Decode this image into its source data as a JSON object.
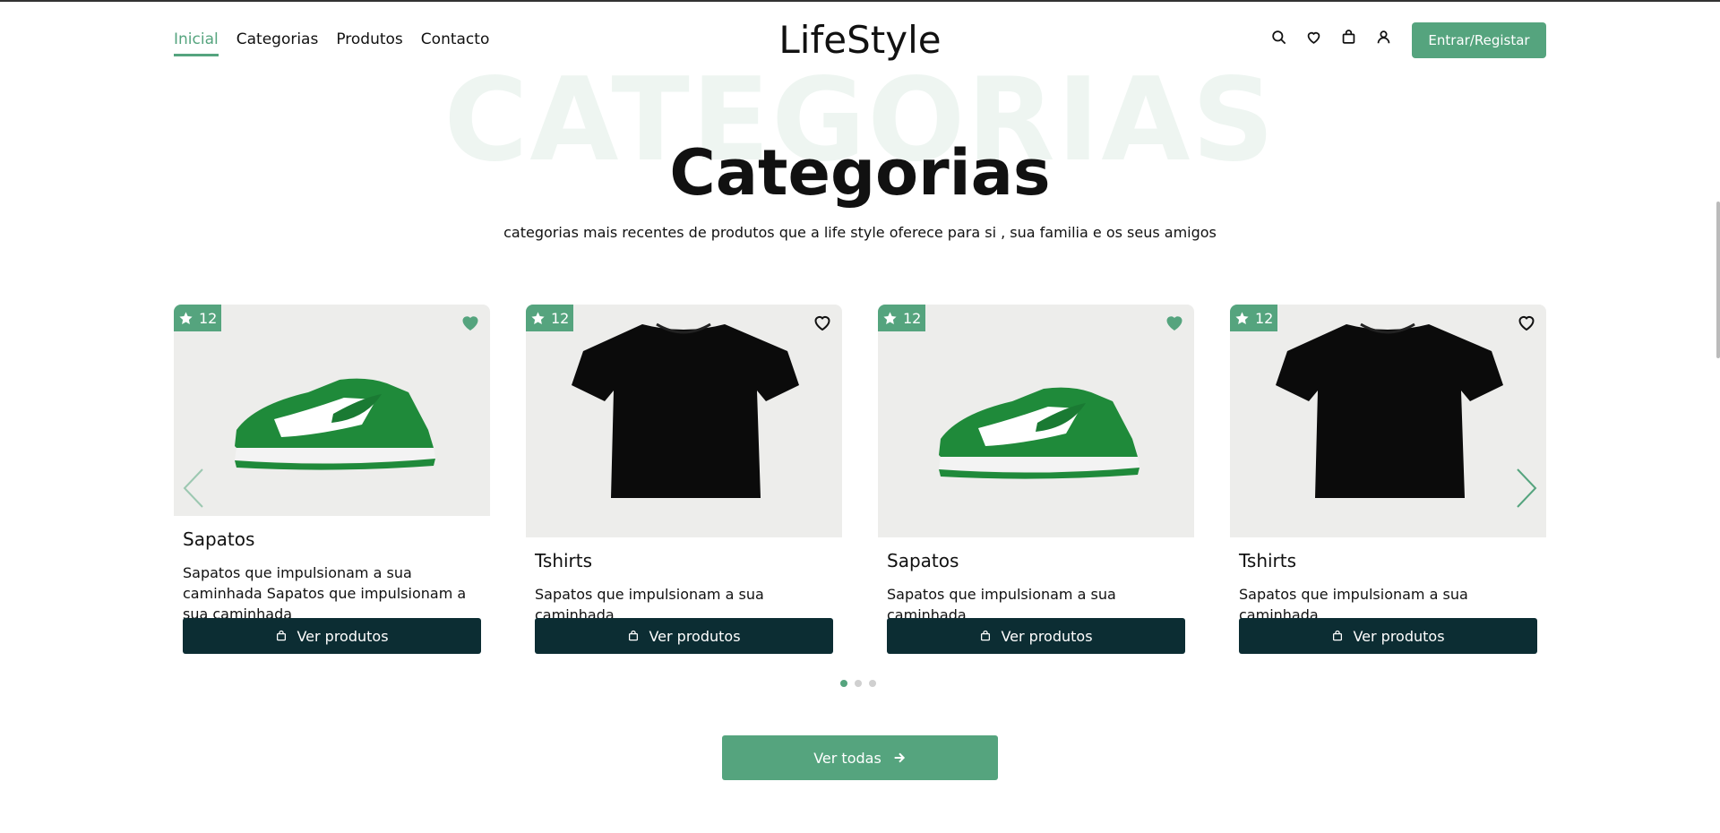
{
  "header": {
    "nav": [
      "Inicial",
      "Categorias",
      "Produtos",
      "Contacto"
    ],
    "active_nav": "Inicial",
    "logo": "LifeStyle",
    "icons": [
      "search-icon",
      "heart-icon",
      "bag-icon",
      "user-icon"
    ],
    "login_label": "Entrar/Registar"
  },
  "section": {
    "ghost_text": "CATEGORIAS",
    "title": "Categorias",
    "subtitle": "categorias mais recentes de produtos que a life style oferece para si , sua familia e os seus amigos"
  },
  "cards": [
    {
      "rating": "12",
      "favorited": true,
      "image": "sneaker",
      "name": "Sapatos",
      "description": "Sapatos que impulsionam a sua caminhada Sapatos que impulsionam a sua caminhada",
      "button": "Ver produtos"
    },
    {
      "rating": "12",
      "favorited": false,
      "image": "tshirt",
      "name": "Tshirts",
      "description": "Sapatos que impulsionam a sua caminhada",
      "button": "Ver produtos"
    },
    {
      "rating": "12",
      "favorited": true,
      "image": "sneaker",
      "name": "Sapatos",
      "description": "Sapatos que impulsionam a sua caminhada",
      "button": "Ver produtos"
    },
    {
      "rating": "12",
      "favorited": false,
      "image": "tshirt",
      "name": "Tshirts",
      "description": "Sapatos que impulsionam a sua caminhada",
      "button": "Ver produtos"
    }
  ],
  "carousel": {
    "pages": 3,
    "active_page": 1
  },
  "view_all_label": "Ver todas",
  "colors": {
    "accent": "#55a47e",
    "dark_button": "#0c2d33",
    "image_bg": "#ededeb"
  }
}
